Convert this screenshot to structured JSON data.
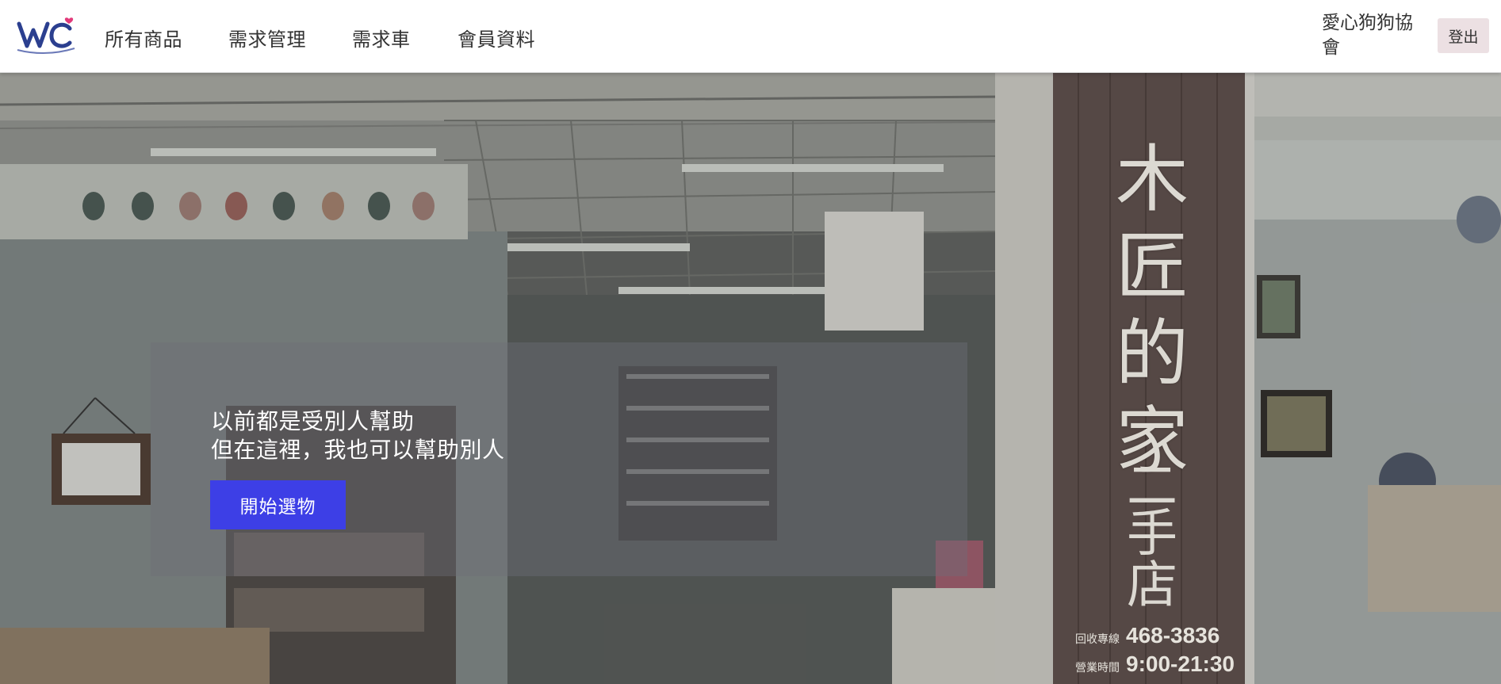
{
  "brand": {
    "logo_text": "WC"
  },
  "nav": {
    "items": [
      {
        "label": "所有商品"
      },
      {
        "label": "需求管理"
      },
      {
        "label": "需求車"
      },
      {
        "label": "會員資料"
      }
    ],
    "org_name": "愛心狗狗協會",
    "logout_label": "登出"
  },
  "hero": {
    "line1": "以前都是受別人幫助",
    "line2": "但在這裡，我也可以幫助別人",
    "cta_label": "開始選物",
    "sign": {
      "chars": [
        "木",
        "匠",
        "的",
        "家"
      ],
      "sub_chars": [
        "二",
        "手",
        "店"
      ],
      "phone_label": "回收專線",
      "phone": "468-3836",
      "hours_label": "營業時間",
      "hours": "9:00-21:30"
    }
  },
  "colors": {
    "cta": "#3d3fe6",
    "logout_bg": "#ece0e3",
    "logo_heart": "#e23a7a",
    "logo_blue": "#2b3f8f"
  }
}
